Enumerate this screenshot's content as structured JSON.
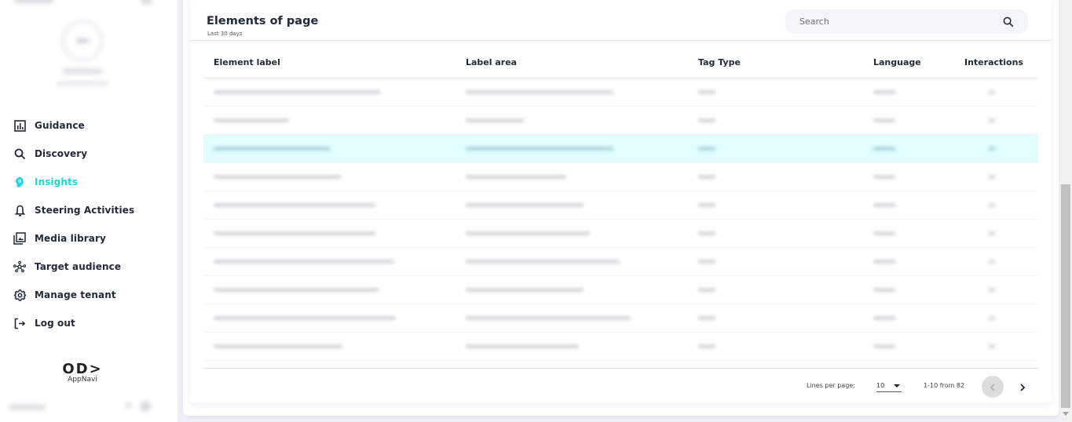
{
  "sidebar": {
    "nav": [
      {
        "label": "Guidance",
        "icon": "bar-chart-icon",
        "active": false
      },
      {
        "label": "Discovery",
        "icon": "search-icon",
        "active": false
      },
      {
        "label": "Insights",
        "icon": "brain-head-icon",
        "active": true
      },
      {
        "label": "Steering Activities",
        "icon": "bell-icon",
        "active": false
      },
      {
        "label": "Media library",
        "icon": "media-library-icon",
        "active": false
      },
      {
        "label": "Target audience",
        "icon": "network-icon",
        "active": false
      },
      {
        "label": "Manage tenant",
        "icon": "gear-icon",
        "active": false
      },
      {
        "label": "Log out",
        "icon": "logout-icon",
        "active": false
      }
    ],
    "logo": {
      "mark": "OD>",
      "text": "AppNavi"
    }
  },
  "card": {
    "title": "Elements of page",
    "subtitle": "Last 30 days",
    "search": {
      "placeholder": "Search",
      "value": ""
    },
    "columns": [
      "Element label",
      "Label area",
      "Tag Type",
      "Language",
      "Interactions"
    ],
    "rows_redacted": true,
    "row_count": 10,
    "highlighted_row": 3,
    "pagination": {
      "lines_per_page_label": "Lines per page:",
      "lines_per_page": "10",
      "range": "1-10 from 82"
    }
  },
  "colors": {
    "accent": "#1ed3e3",
    "highlight_row": "#e1fdfe",
    "text": "#1f2a3c",
    "background": "#eef0f7"
  }
}
